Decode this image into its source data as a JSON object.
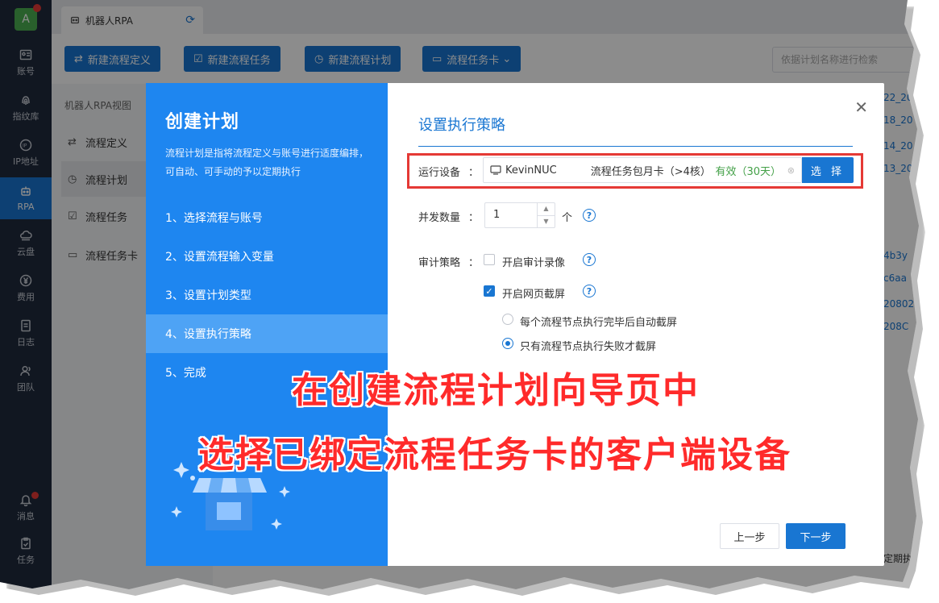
{
  "rail": {
    "avatar_letter": "A",
    "items": [
      {
        "label": "账号",
        "icon": "id-card-icon"
      },
      {
        "label": "指纹库",
        "icon": "fingerprint-icon"
      },
      {
        "label": "IP地址",
        "icon": "ip-icon"
      },
      {
        "label": "RPA",
        "icon": "robot-icon",
        "active": true
      },
      {
        "label": "云盘",
        "icon": "cloud-icon"
      },
      {
        "label": "费用",
        "icon": "yen-icon"
      },
      {
        "label": "日志",
        "icon": "log-icon"
      },
      {
        "label": "团队",
        "icon": "team-icon"
      },
      {
        "label": "消息",
        "icon": "bell-icon"
      },
      {
        "label": "任务",
        "icon": "clipboard-icon"
      }
    ]
  },
  "tab": {
    "label": "机器人RPA",
    "icon": "robot-icon",
    "refresh_icon": "refresh-icon"
  },
  "toolbar": {
    "buttons": [
      "新建流程定义",
      "新建流程任务",
      "新建流程计划",
      "流程任务卡"
    ],
    "search_placeholder": "依据计划名称进行检索"
  },
  "subside": {
    "header": "机器人RPA视图",
    "items": [
      "流程定义",
      "流程计划",
      "流程任务",
      "流程任务卡"
    ],
    "active": "流程计划"
  },
  "background_links": [
    "22_20",
    "18_20",
    "14_20",
    "13_20",
    "4b3y",
    "c6aa",
    "20802",
    "208C",
    "定期执"
  ],
  "dialog": {
    "title": "创建计划",
    "description": "流程计划是指将流程定义与账号进行适度编排，可自动、可手动的予以定期执行",
    "steps": [
      "1、选择流程与账号",
      "2、设置流程输入变量",
      "3、设置计划类型",
      "4、设置执行策略",
      "5、完成"
    ],
    "active_step": 3,
    "section_title": "设置执行策略",
    "device": {
      "label": "运行设备",
      "colon": "：",
      "name": "KevinNUC",
      "card": "流程任务包月卡（>4核）",
      "status": "有效（30天）",
      "select_button": "选 择"
    },
    "concurrency": {
      "label": "并发数量",
      "colon": "：",
      "value": "1",
      "unit": "个"
    },
    "audit": {
      "label": "审计策略",
      "colon": "：",
      "record_label": "开启审计录像",
      "record_checked": false,
      "screenshot_label": "开启网页截屏",
      "screenshot_checked": true,
      "options": [
        "每个流程节点执行完毕后自动截屏",
        "只有流程节点执行失败才截屏"
      ],
      "selected_option": 1
    },
    "prev_button": "上一步",
    "next_button": "下一步",
    "close_icon": "close-icon"
  },
  "captions": [
    "在创建流程计划向导页中",
    "选择已绑定流程任务卡的客户端设备"
  ],
  "colors": {
    "primary": "#1976d2",
    "dialog_left": "#1e86f0",
    "rail": "#1f2a3c",
    "annotation": "#ff2a2a",
    "valid": "#43a047"
  }
}
